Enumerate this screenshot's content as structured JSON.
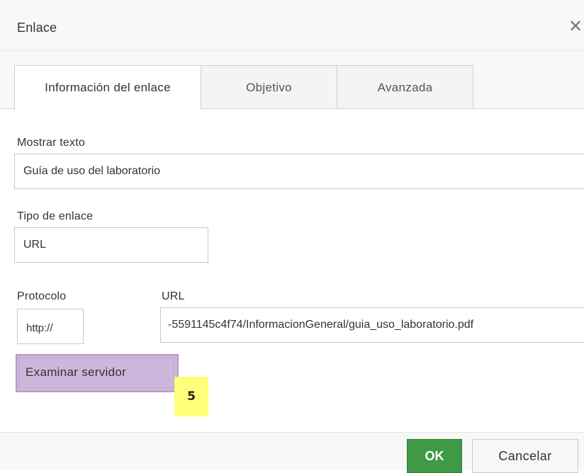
{
  "dialog": {
    "title": "Enlace",
    "close_symbol": "✕"
  },
  "tabs": [
    {
      "label": "Información del enlace",
      "active": true
    },
    {
      "label": "Objetivo",
      "active": false
    },
    {
      "label": "Avanzada",
      "active": false
    }
  ],
  "fields": {
    "display_text": {
      "label": "Mostrar texto",
      "value": "Guía de uso del laboratorio"
    },
    "link_type": {
      "label": "Tipo de enlace",
      "value": "URL"
    },
    "protocol": {
      "label": "Protocolo",
      "value": "http://"
    },
    "url": {
      "label": "URL",
      "value": "-5591145c4f74/InformacionGeneral/guia_uso_laboratorio.pdf"
    }
  },
  "browse_button": {
    "label": "Examinar servidor",
    "highlight_color": "#cdb6dc"
  },
  "annotation": {
    "number": "5",
    "color": "#ffff7a"
  },
  "footer": {
    "ok_label": "OK",
    "cancel_label": "Cancelar",
    "ok_color": "#3f9a48"
  }
}
